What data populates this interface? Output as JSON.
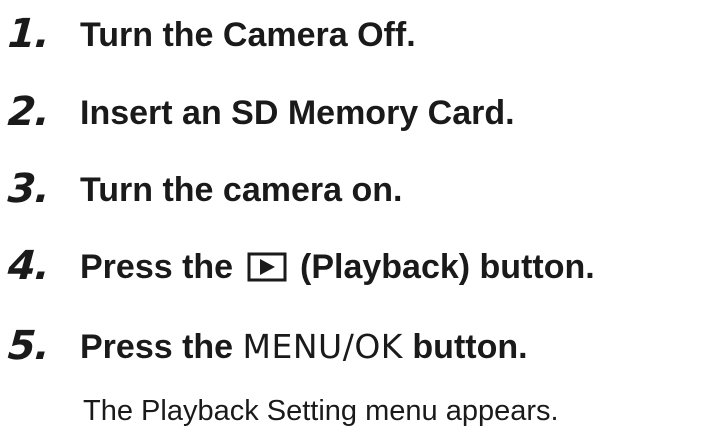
{
  "steps": [
    {
      "number": "1.",
      "text": "Turn the Camera Off."
    },
    {
      "number": "2.",
      "text": "Insert an SD Memory Card."
    },
    {
      "number": "3.",
      "text": "Turn the camera on."
    },
    {
      "number": "4.",
      "text_before": "Press the",
      "icon": "playback-icon",
      "text_after": "(Playback) button."
    },
    {
      "number": "5.",
      "text_before": "Press the",
      "button_name": "MENU/OK",
      "text_after": "button."
    }
  ],
  "note": "The Playback Setting menu appears."
}
